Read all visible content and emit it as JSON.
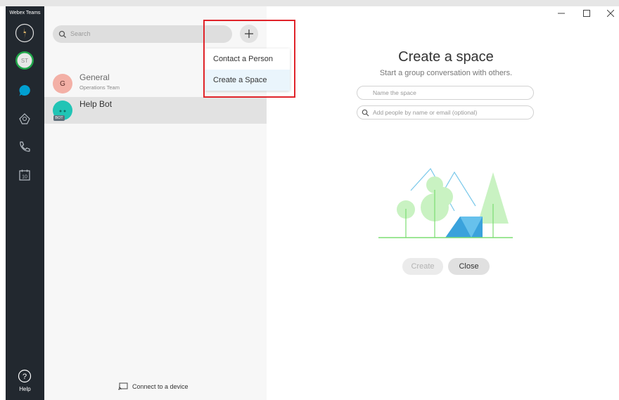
{
  "app": {
    "title": "Webex Teams",
    "avatar_initials": "ST"
  },
  "rail": {
    "help_label": "Help",
    "calendar_day": "10"
  },
  "search": {
    "placeholder": "Search"
  },
  "spaces": [
    {
      "initial": "G",
      "title": "General",
      "subtitle": "Operations Team",
      "avatar_color": "#f3b0a6"
    },
    {
      "title": "Help Bot",
      "badge": "BOT",
      "avatar_color": "#21c4b5"
    }
  ],
  "menu": {
    "items": [
      "Contact a Person",
      "Create a Space"
    ],
    "highlighted": "Create a Space"
  },
  "footer": {
    "connect_label": "Connect to a device"
  },
  "create_space": {
    "title": "Create a space",
    "subtitle": "Start a group conversation with others.",
    "name_placeholder": "Name the space",
    "people_placeholder": "Add people by name or email (optional)",
    "create_label": "Create",
    "close_label": "Close"
  },
  "colors": {
    "rail": "#22282f",
    "highlight_box": "#e0242a",
    "accent_chat": "#00a0d1"
  }
}
